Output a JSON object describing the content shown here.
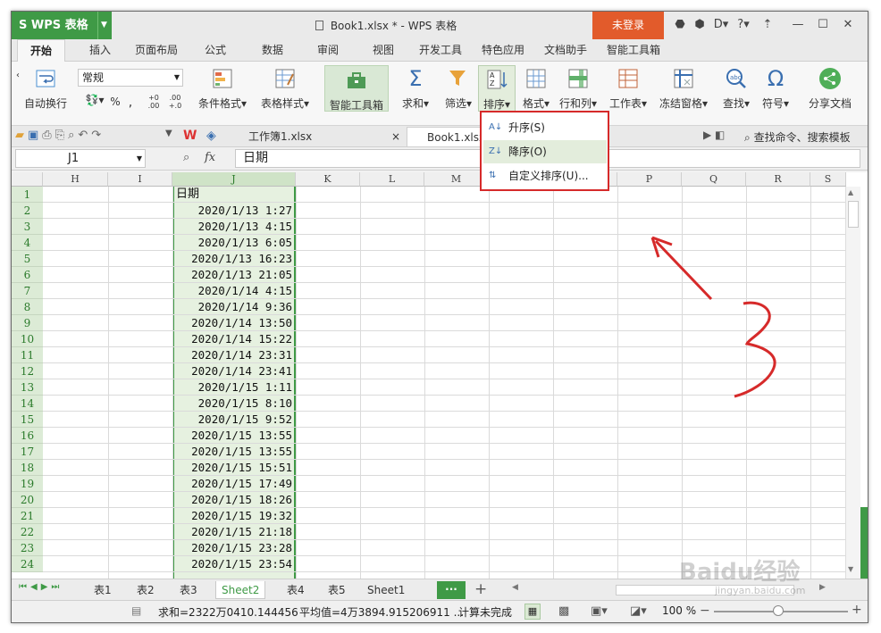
{
  "app": {
    "logo": "S WPS 表格",
    "doc_title": "Book1.xlsx * - WPS 表格",
    "login": "未登录",
    "help": "?"
  },
  "ribbon_tabs": [
    "开始",
    "插入",
    "页面布局",
    "公式",
    "数据",
    "审阅",
    "视图",
    "开发工具",
    "特色应用",
    "文档助手",
    "智能工具箱"
  ],
  "ribbon": {
    "wrap": "自动换行",
    "number_format": "常规",
    "percent": "%",
    "cond_format": "条件格式",
    "table_style": "表格样式",
    "smart_toolbox": "智能工具箱",
    "sum": "求和",
    "filter": "筛选",
    "sort": "排序",
    "format": "格式",
    "rowcol": "行和列",
    "worksheet": "工作表",
    "freeze": "冻结窗格",
    "find": "查找",
    "symbol": "符号",
    "share": "分享文档"
  },
  "file_tabs": [
    "工作簿1.xlsx",
    "Book1.xlsx"
  ],
  "quick_search": "查找命令、搜索模板",
  "formula": {
    "name_box": "J1",
    "fx": "fx",
    "content": "日期"
  },
  "columns": [
    "H",
    "I",
    "J",
    "K",
    "L",
    "M",
    "N",
    "O",
    "P",
    "Q",
    "R",
    "S"
  ],
  "rows": [
    "1",
    "2",
    "3",
    "4",
    "5",
    "6",
    "7",
    "8",
    "9",
    "10",
    "11",
    "12",
    "13",
    "14",
    "15",
    "16",
    "17",
    "18",
    "19",
    "20",
    "21",
    "22",
    "23",
    "24"
  ],
  "cells": [
    "日期",
    "2020/1/13 1:27",
    "2020/1/13 4:15",
    "2020/1/13 6:05",
    "2020/1/13 16:23",
    "2020/1/13 21:05",
    "2020/1/14 4:15",
    "2020/1/14 9:36",
    "2020/1/14 13:50",
    "2020/1/14 15:22",
    "2020/1/14 23:31",
    "2020/1/14 23:41",
    "2020/1/15 1:11",
    "2020/1/15 8:10",
    "2020/1/15 9:52",
    "2020/1/15 13:55",
    "2020/1/15 13:55",
    "2020/1/15 15:51",
    "2020/1/15 17:49",
    "2020/1/15 18:26",
    "2020/1/15 19:32",
    "2020/1/15 21:18",
    "2020/1/15 23:28",
    "2020/1/15 23:54"
  ],
  "sort_menu": {
    "ascending": "升序(S)",
    "descending": "降序(O)",
    "custom": "自定义排序(U)..."
  },
  "sheets": [
    "表1",
    "表2",
    "表3",
    "Sheet2",
    "表4",
    "表5",
    "Sheet1"
  ],
  "active_sheet": "Sheet2",
  "status": {
    "sum": "求和=2322万0410.144456",
    "avg": "平均值=4万3894.915206911 ...",
    "calc": "计算未完成",
    "zoom": "100 %"
  },
  "annotation_number": "3",
  "watermark": "Baidu经验",
  "watermark_sub": "jingyan.baidu.com",
  "colors": {
    "brand_green": "#3f9a46",
    "login_orange": "#e25b2b",
    "annotation_red": "#d62a2a"
  }
}
